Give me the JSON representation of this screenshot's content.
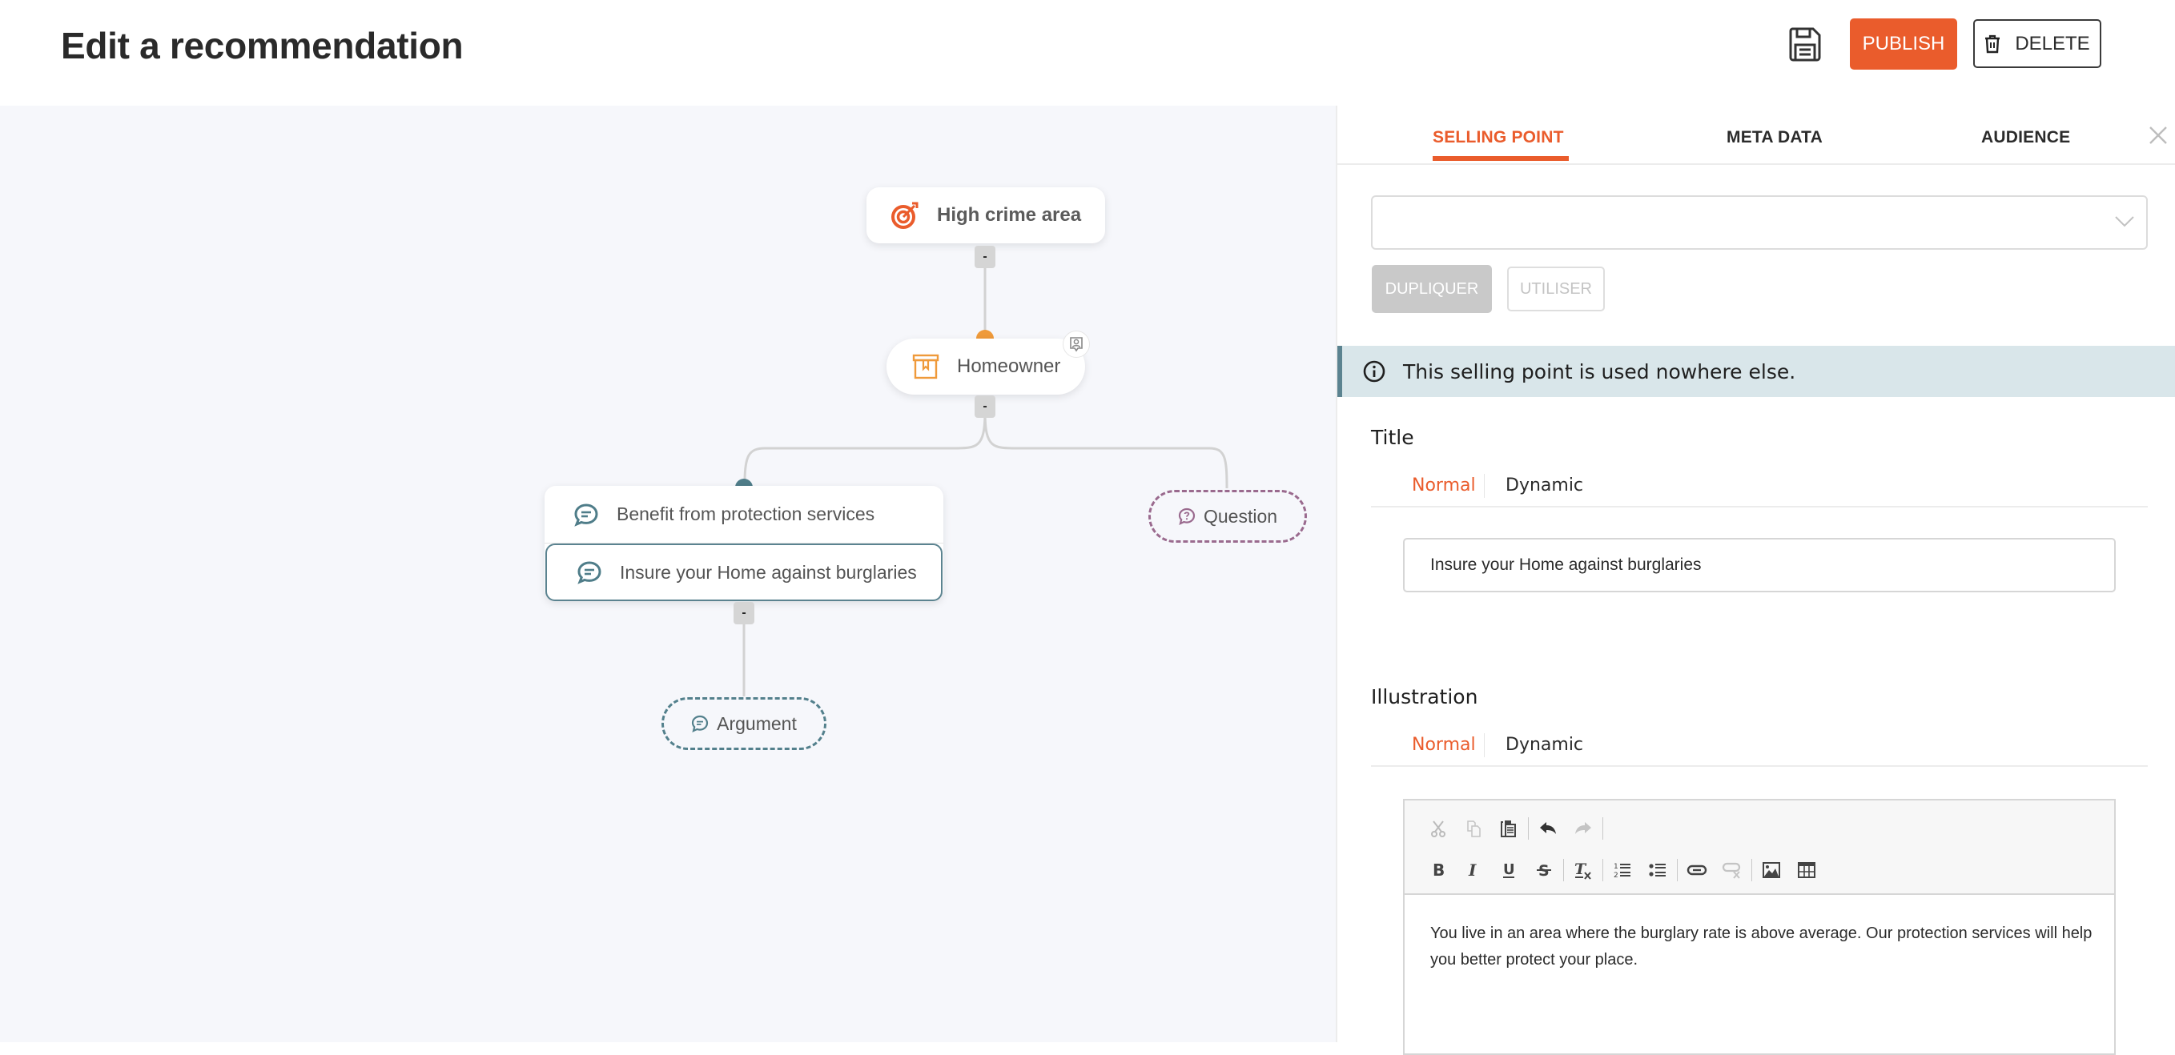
{
  "header": {
    "title": "Edit a recommendation",
    "save_icon": "floppy-disk-icon",
    "publish_label": "PUBLISH",
    "delete_label": "DELETE",
    "delete_icon": "trash-icon"
  },
  "colors": {
    "accent": "#ea5c2c",
    "teal": "#5b8390",
    "question_purple": "#9a6a8e",
    "persona_orange": "#ef9a3a",
    "info_bg": "#d9e6ea"
  },
  "tree": {
    "root": {
      "label": "High crime area",
      "icon": "target-icon"
    },
    "persona": {
      "label": "Homeowner",
      "icon": "box-icon",
      "badge_icon": "user-badge-icon"
    },
    "selling_points": [
      {
        "label": "Benefit from protection services",
        "icon": "chat-icon",
        "selected": false
      },
      {
        "label": "Insure your Home against burglaries",
        "icon": "chat-icon",
        "selected": true
      }
    ],
    "question_placeholder": {
      "label": "Question",
      "icon": "question-bubble-icon"
    },
    "argument_placeholder": {
      "label": "Argument",
      "icon": "chat-icon"
    },
    "collapse_label": "-"
  },
  "panel": {
    "tabs": [
      {
        "label": "SELLING POINT",
        "active": true
      },
      {
        "label": "META DATA",
        "active": false
      },
      {
        "label": "AUDIENCE",
        "active": false
      }
    ],
    "selector_value": "",
    "duplicate_label": "DUPLIQUER",
    "use_label": "UTILISER",
    "info_message": "This selling point is used nowhere else.",
    "title_section": {
      "label": "Title",
      "modes": [
        "Normal",
        "Dynamic"
      ],
      "active_mode": "Normal",
      "value": "Insure your Home against burglaries"
    },
    "illustration_section": {
      "label": "Illustration",
      "modes": [
        "Normal",
        "Dynamic"
      ],
      "active_mode": "Normal",
      "toolbar_row1": [
        "cut-icon",
        "copy-icon",
        "paste-icon",
        "undo-icon",
        "redo-icon"
      ],
      "toolbar_row2": [
        "bold-icon",
        "italic-icon",
        "underline-icon",
        "strikethrough-icon",
        "clear-format-icon",
        "numbered-list-icon",
        "bulleted-list-icon",
        "link-icon",
        "unlink-icon",
        "image-icon",
        "table-icon"
      ],
      "body": "You live in an area where the burglary rate is above average. Our protection services will help you better protect your place."
    }
  }
}
